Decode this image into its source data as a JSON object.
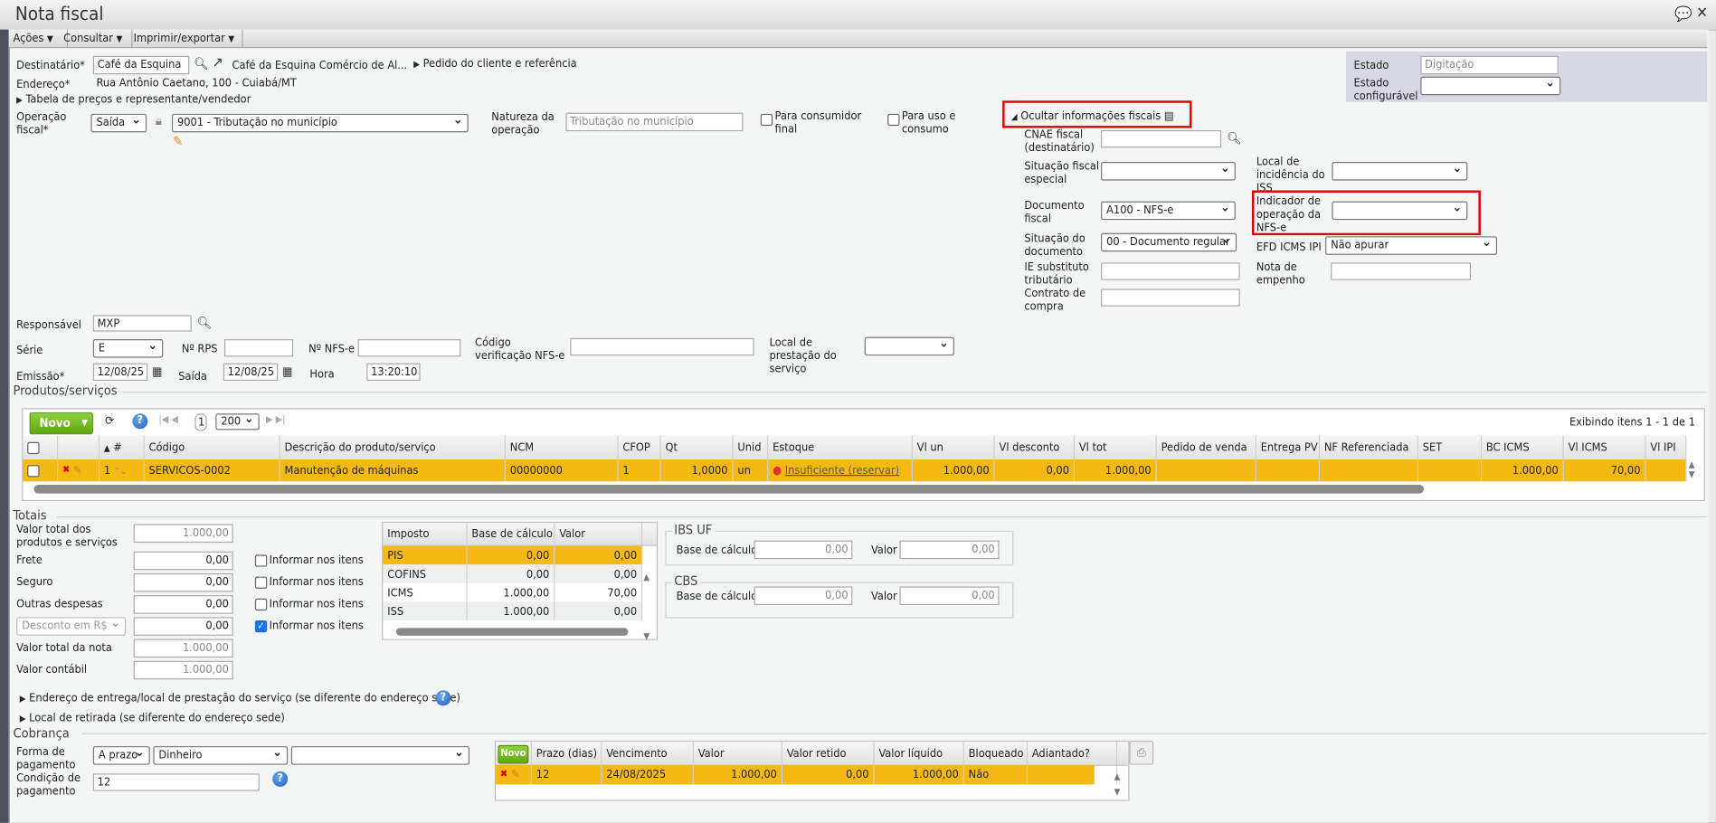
{
  "window": {
    "title": "Nota fiscal"
  },
  "menubar": [
    "Ações",
    "Consultar",
    "Imprimir/exportar"
  ],
  "header": {
    "destinatario_label": "Destinatário*",
    "destinatario_value": "Café da Esquina",
    "destinatario_name": "Café da Esquina Comércio de Al...",
    "pedido_link": "Pedido do cliente e referência",
    "endereco_label": "Endereço*",
    "endereco_value": "Rua Antônio Caetano, 100 - Cuiabá/MT",
    "tabela_link": "Tabela de preços e representante/vendedor",
    "operacao_label": "Operação fiscal*",
    "operacao_tipo": "Saída",
    "operacao_value": "9001 - Tributação no município",
    "natureza_label": "Natureza da operação",
    "natureza_placeholder": "Tributação no município",
    "consumidor_final": "Para consumidor final",
    "uso_consumo": "Para uso e consumo"
  },
  "estado": {
    "estado_label": "Estado",
    "estado_value": "Digitação",
    "config_label": "Estado configurável",
    "config_value": ""
  },
  "fiscal": {
    "toggle": "Ocultar informações fiscais",
    "cnae_label": "CNAE fiscal (destinatário)",
    "situacao_especial_label": "Situação fiscal especial",
    "local_iss_label": "Local de incidência do ISS",
    "documento_label": "Documento fiscal",
    "documento_value": "A100 - NFS-e",
    "indicador_label": "Indicador de operação da NFS-e",
    "indicador_value": "",
    "situacao_doc_label": "Situação do documento",
    "situacao_doc_value": "00 - Documento regular",
    "efd_label": "EFD ICMS IPI",
    "efd_value": "Não apurar",
    "ie_label": "IE substituto tributário",
    "empenho_label": "Nota de empenho",
    "contrato_label": "Contrato de compra"
  },
  "info": {
    "responsavel_label": "Responsável",
    "responsavel_value": "MXP",
    "serie_label": "Série",
    "serie_value": "E",
    "rps_label": "Nº RPS",
    "nfse_label": "Nº NFS-e",
    "codigo_label": "Código verificação NFS-e",
    "local_prest_label": "Local de prestação do serviço",
    "emissao_label": "Emissão*",
    "emissao_value": "12/08/25",
    "saida_label": "Saída",
    "saida_value": "12/08/25",
    "hora_label": "Hora",
    "hora_value": "13:20:10"
  },
  "produtos": {
    "legend": "Produtos/serviços",
    "novo": "Novo",
    "page": "1",
    "page_size": "200",
    "exibindo": "Exibindo itens 1 - 1 de 1",
    "columns": [
      "#",
      "Código",
      "Descrição do produto/serviço",
      "NCM",
      "CFOP",
      "Qt",
      "Unid",
      "Estoque",
      "Vl un",
      "Vl desconto",
      "Vl tot",
      "Pedido de venda",
      "Entrega PV",
      "NF Referenciada",
      "SET",
      "BC ICMS",
      "Vl ICMS",
      "Vl IPI"
    ],
    "rows": [
      {
        "num": "1",
        "codigo": "SERVICOS-0002",
        "descricao": "Manutenção de máquinas",
        "ncm": "00000000",
        "cfop": "1",
        "qt": "1,0000",
        "unid": "un",
        "estoque": "Insuficiente (reservar)",
        "vl_un": "1.000,00",
        "vl_desconto": "0,00",
        "vl_tot": "1.000,00",
        "pedido": "",
        "entrega": "",
        "nf_ref": "",
        "set": "",
        "bc_icms": "1.000,00",
        "vl_icms": "70,00",
        "vl_ipi": ""
      }
    ]
  },
  "totais": {
    "legend": "Totais",
    "rows": [
      {
        "label": "Valor total dos produtos e serviços",
        "value": "1.000,00"
      },
      {
        "label": "Frete",
        "value": "0,00",
        "check": "Informar nos itens",
        "checked": false
      },
      {
        "label": "Seguro",
        "value": "0,00",
        "check": "Informar nos itens",
        "checked": false
      },
      {
        "label": "Outras despesas",
        "value": "0,00",
        "check": "Informar nos itens",
        "checked": false
      },
      {
        "label": "Desconto em R$",
        "value": "0,00",
        "check": "Informar nos itens",
        "checked": true
      },
      {
        "label": "Valor total da nota",
        "value": "1.000,00"
      },
      {
        "label": "Valor contábil",
        "value": "1.000,00"
      }
    ],
    "tax_columns": [
      "Imposto",
      "Base de cálculo",
      "Valor"
    ],
    "taxes": [
      {
        "imposto": "PIS",
        "base": "0,00",
        "valor": "0,00"
      },
      {
        "imposto": "COFINS",
        "base": "0,00",
        "valor": "0,00"
      },
      {
        "imposto": "ICMS",
        "base": "1.000,00",
        "valor": "70,00"
      },
      {
        "imposto": "ISS",
        "base": "1.000,00",
        "valor": "0,00"
      }
    ],
    "ibs": {
      "legend": "IBS UF",
      "base_label": "Base de cálculo",
      "base": "0,00",
      "valor_label": "Valor",
      "valor": "0,00"
    },
    "cbs": {
      "legend": "CBS",
      "base_label": "Base de cálculo",
      "base": "0,00",
      "valor_label": "Valor",
      "valor": "0,00"
    }
  },
  "links": {
    "entrega": "Endereço de entrega/local de prestação do serviço (se diferente do endereço sede)",
    "retirada": "Local de retirada (se diferente do endereço sede)"
  },
  "cobranca": {
    "legend": "Cobrança",
    "forma_label": "Forma de pagamento",
    "forma_tipo": "A prazo",
    "forma_meio": "Dinheiro",
    "forma_extra": "",
    "condicao_label": "Condição de pagamento",
    "condicao_value": "12",
    "novo": "Novo",
    "columns": [
      "Prazo (dias)",
      "Vencimento",
      "Valor",
      "Valor retido",
      "Valor líquido",
      "Bloqueado",
      "Adiantado?"
    ],
    "rows": [
      {
        "prazo": "12",
        "vencimento": "24/08/2025",
        "valor": "1.000,00",
        "retido": "0,00",
        "liquido": "1.000,00",
        "bloqueado": "Não",
        "adiantado": ""
      }
    ]
  }
}
